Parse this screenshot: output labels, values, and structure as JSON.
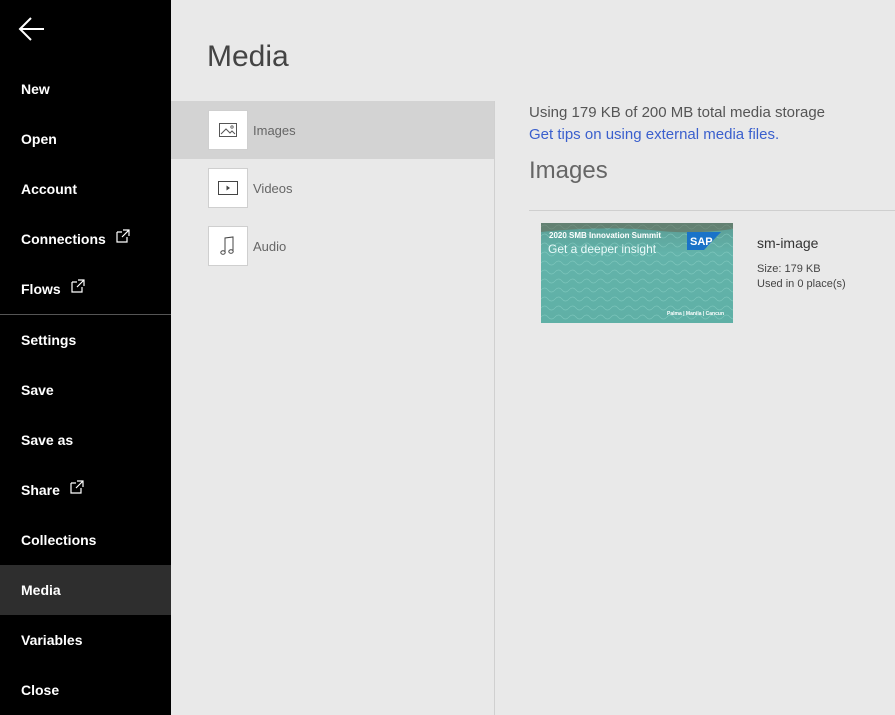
{
  "sidebar": {
    "back_icon": "arrow-left-icon",
    "items": [
      {
        "label": "New"
      },
      {
        "label": "Open"
      },
      {
        "label": "Account"
      },
      {
        "label": "Connections",
        "external": true
      },
      {
        "label": "Flows",
        "external": true
      },
      {
        "label": "Settings"
      },
      {
        "label": "Save"
      },
      {
        "label": "Save as"
      },
      {
        "label": "Share",
        "external": true
      },
      {
        "label": "Collections"
      },
      {
        "label": "Media",
        "active": true
      },
      {
        "label": "Variables"
      },
      {
        "label": "Close"
      }
    ]
  },
  "page": {
    "title": "Media"
  },
  "media_types": [
    {
      "label": "Images",
      "icon": "image-icon",
      "selected": true
    },
    {
      "label": "Videos",
      "icon": "video-icon"
    },
    {
      "label": "Audio",
      "icon": "music-note-icon"
    }
  ],
  "content": {
    "usage_text": "Using 179 KB of 200 MB total media storage",
    "tips_link": "Get tips on using external media files.",
    "section_title": "Images",
    "file": {
      "name": "sm-image",
      "size": "Size: 179 KB",
      "used": "Used in 0 place(s)",
      "thumbnail": {
        "title": "2020 SMB Innovation Summit",
        "subtitle": "Get a deeper insight",
        "logo_text": "SAP",
        "footer": "Palma | Manila | Cancun"
      }
    }
  },
  "colors": {
    "sidebar_bg": "#000000",
    "active_item_bg": "#2e2e2e",
    "content_bg": "#e9e9e9",
    "selected_bg": "#d3d3d3",
    "link": "#3a5fcd"
  }
}
